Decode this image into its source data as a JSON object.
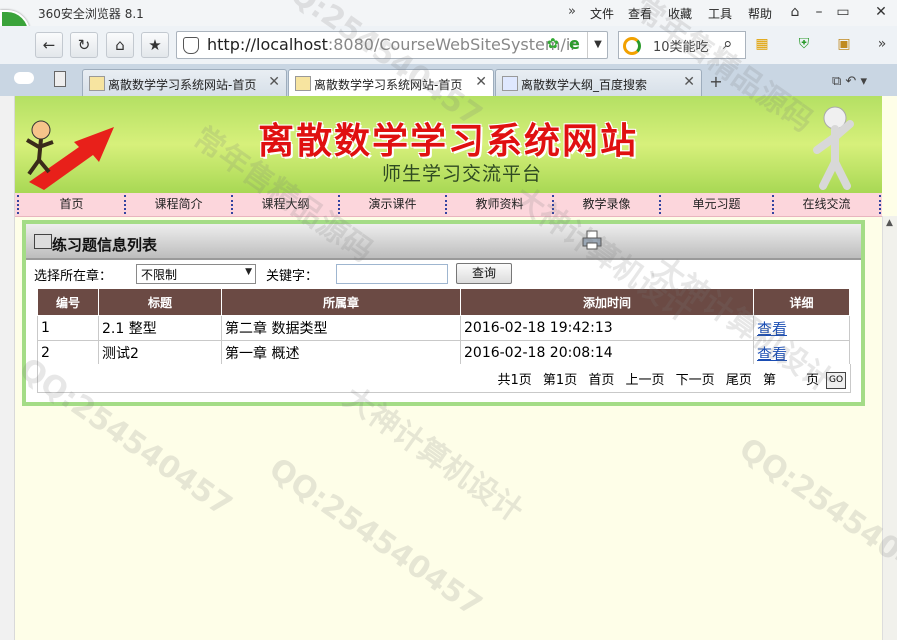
{
  "browser": {
    "app_title": "360安全浏览器 8.1",
    "menu": [
      "文件",
      "查看",
      "收藏",
      "工具",
      "帮助"
    ],
    "url_host": "http://localhost",
    "url_rest": ":8080/CourseWebSiteSystem/ir",
    "search_text": "10类能吃",
    "tabs": [
      {
        "label": "离散数学学习系统网站-首页",
        "active": false
      },
      {
        "label": "离散数学学习系统网站-首页",
        "active": true
      },
      {
        "label": "离散数学大纲_百度搜索",
        "active": false
      }
    ]
  },
  "site": {
    "title": "离散数学学习系统网站",
    "subtitle": "师生学习交流平台",
    "nav": [
      "首页",
      "课程简介",
      "课程大纲",
      "演示课件",
      "教师资料",
      "教学录像",
      "单元习题",
      "在线交流"
    ]
  },
  "panel": {
    "title": "练习题信息列表",
    "chapter_label": "选择所在章：",
    "chapter_value": "不限制",
    "keyword_label": "关键字：",
    "keyword_value": "",
    "query_label": "查询",
    "columns": [
      "编号",
      "标题",
      "所属章",
      "添加时间",
      "详细"
    ],
    "rows": [
      {
        "id": "1",
        "title": "2.1 整型",
        "chapter": "第二章  数据类型",
        "time": "2016-02-18 19:42:13",
        "link": "查看"
      },
      {
        "id": "2",
        "title": "测试2",
        "chapter": "第一章  概述",
        "time": "2016-02-18 20:08:14",
        "link": "查看"
      }
    ],
    "pager": {
      "total": "共1页",
      "current": "第1页",
      "first": "首页",
      "prev": "上一页",
      "next": "下一页",
      "last": "尾页",
      "goto_prefix": "第",
      "goto_suffix": "页",
      "go": "GO"
    }
  },
  "watermarks": [
    "QQ:254540457",
    "大神计算机设计",
    "常年售精品源码"
  ]
}
